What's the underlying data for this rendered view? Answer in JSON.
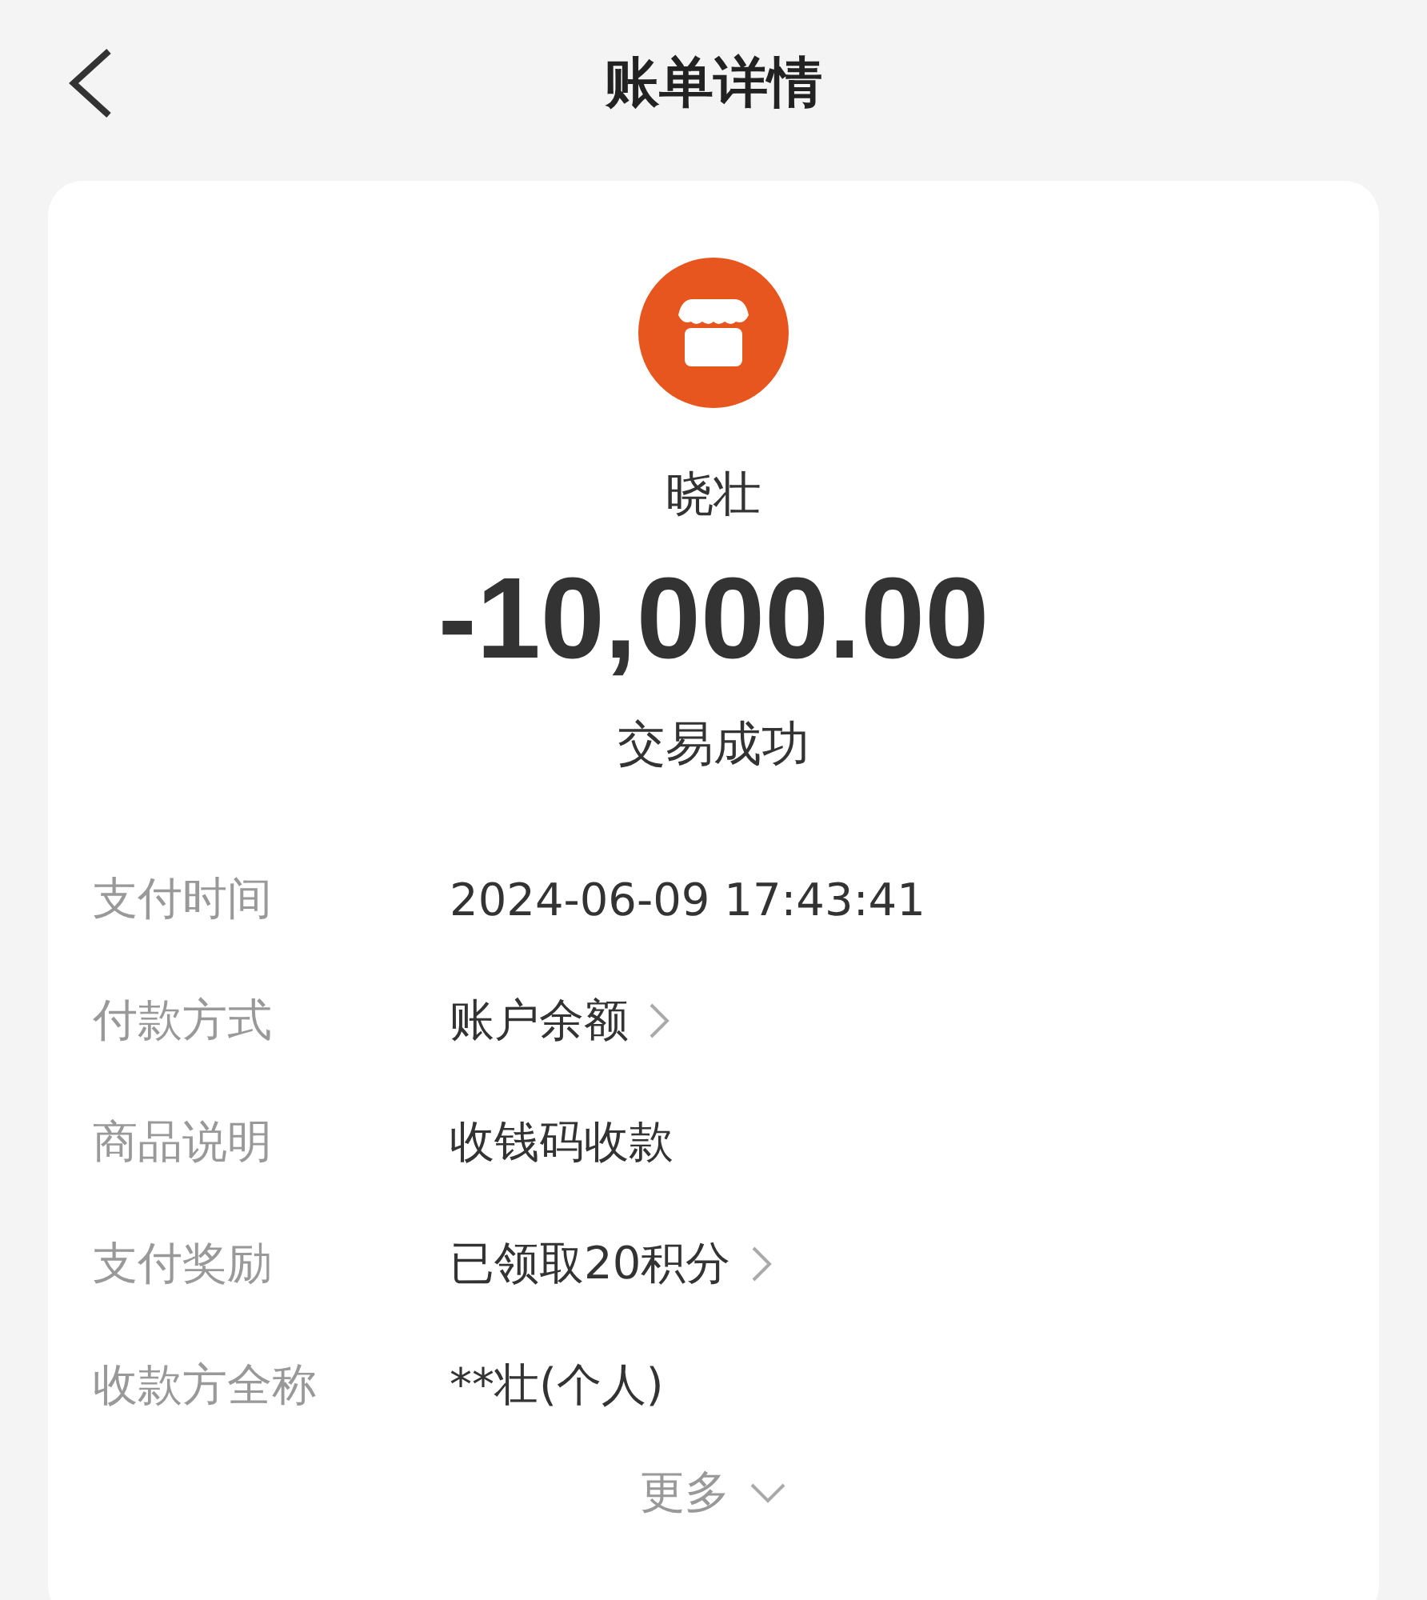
{
  "header": {
    "title": "账单详情"
  },
  "merchant": {
    "name": "晓壮"
  },
  "amount": "-10,000.00",
  "status": "交易成功",
  "details": [
    {
      "label": "支付时间",
      "value": "2024-06-09 17:43:41",
      "kind": "text"
    },
    {
      "label": "付款方式",
      "value": "账户余额",
      "kind": "link"
    },
    {
      "label": "商品说明",
      "value": "收钱码收款",
      "kind": "text"
    },
    {
      "label": "支付奖励",
      "value": "已领取20积分",
      "kind": "link"
    },
    {
      "label": "收款方全称",
      "value": "**壮(个人)",
      "kind": "text"
    }
  ],
  "more": "更多"
}
